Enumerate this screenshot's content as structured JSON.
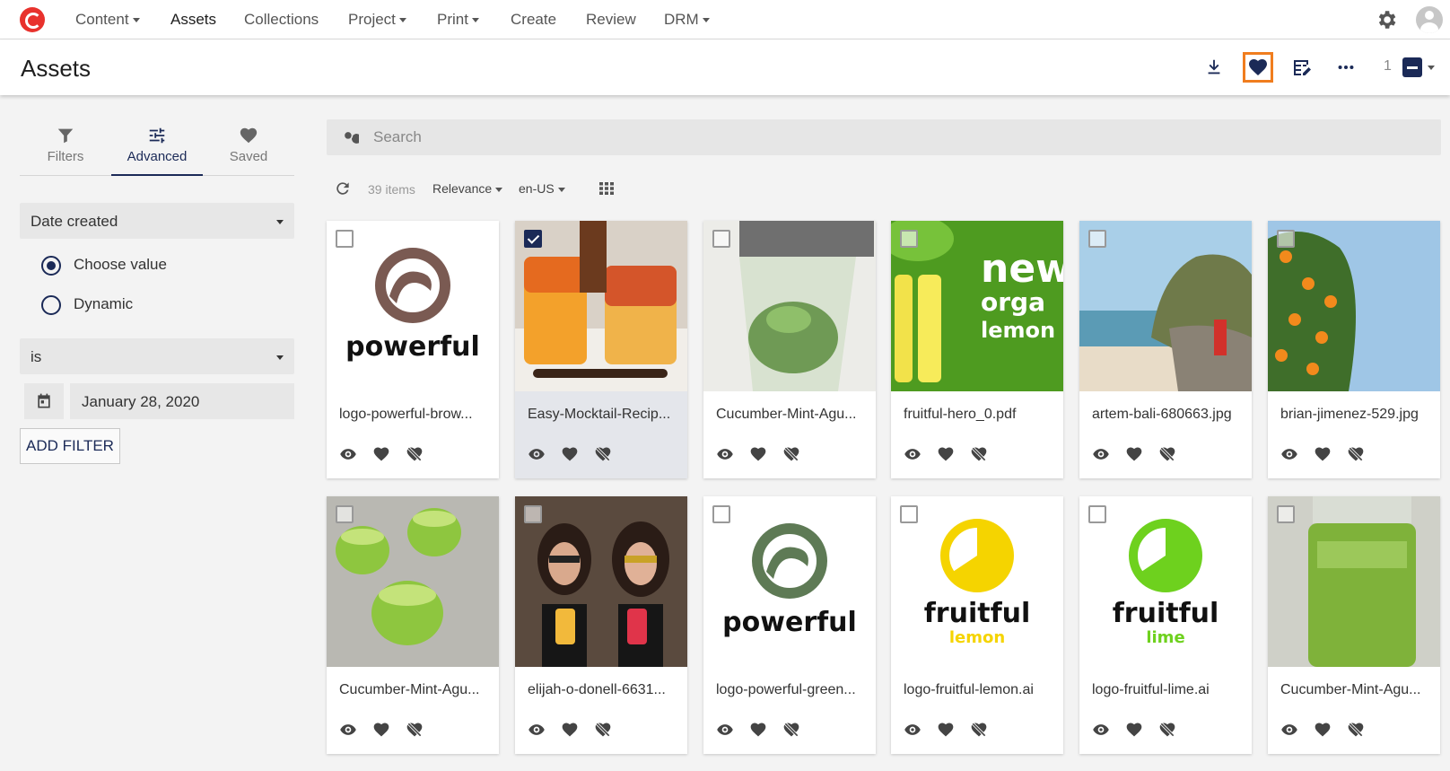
{
  "topnav": {
    "items": [
      {
        "label": "Content",
        "dropdown": true
      },
      {
        "label": "Assets",
        "dropdown": false,
        "active": true
      },
      {
        "label": "Collections",
        "dropdown": false
      },
      {
        "label": "Project",
        "dropdown": true
      },
      {
        "label": "Print",
        "dropdown": true
      },
      {
        "label": "Create",
        "dropdown": false
      },
      {
        "label": "Review",
        "dropdown": false
      },
      {
        "label": "DRM",
        "dropdown": true
      }
    ],
    "settings_icon": "gear-icon",
    "avatar_icon": "user-avatar-icon"
  },
  "header": {
    "title": "Assets",
    "actions": [
      "download-icon",
      "heart-icon",
      "edit-table-icon",
      "more-icon"
    ],
    "selected_count": "1",
    "accent": "#f07d1e"
  },
  "sidebar": {
    "tabs": [
      {
        "label": "Filters",
        "icon": "filter-icon"
      },
      {
        "label": "Advanced",
        "icon": "sliders-icon",
        "active": true
      },
      {
        "label": "Saved",
        "icon": "heart-icon"
      }
    ],
    "field_select": "Date created",
    "radio_options": [
      {
        "label": "Choose value",
        "checked": true
      },
      {
        "label": "Dynamic",
        "checked": false
      }
    ],
    "operator_select": "is",
    "date_value": "January 28, 2020",
    "add_filter_label": "ADD FILTER"
  },
  "search": {
    "placeholder": "Search"
  },
  "toolbar": {
    "count": "39 items",
    "sort": "Relevance",
    "locale": "en-US"
  },
  "assets": [
    {
      "name": "logo-powerful-brow...",
      "thumb": "logo-powerful-brown",
      "selected": false
    },
    {
      "name": "Easy-Mocktail-Recip...",
      "thumb": "mocktail",
      "selected": true
    },
    {
      "name": "Cucumber-Mint-Agu...",
      "thumb": "blender",
      "selected": false
    },
    {
      "name": "fruitful-hero_0.pdf",
      "thumb": "fruitful-hero",
      "selected": false
    },
    {
      "name": "artem-bali-680663.jpg",
      "thumb": "beach",
      "selected": false
    },
    {
      "name": "brian-jimenez-529.jpg",
      "thumb": "orange-tree",
      "selected": false
    },
    {
      "name": "Cucumber-Mint-Agu...",
      "thumb": "green-glasses",
      "selected": false
    },
    {
      "name": "elijah-o-donell-6631...",
      "thumb": "two-girls",
      "selected": false
    },
    {
      "name": "logo-powerful-green...",
      "thumb": "logo-powerful-green",
      "selected": false
    },
    {
      "name": "logo-fruitful-lemon.ai",
      "thumb": "logo-fruitful-lemon",
      "selected": false
    },
    {
      "name": "logo-fruitful-lime.ai",
      "thumb": "logo-fruitful-lime",
      "selected": false
    },
    {
      "name": "Cucumber-Mint-Agu...",
      "thumb": "green-jar",
      "selected": false
    }
  ],
  "thumb_text": {
    "powerful": "powerful",
    "fruitful": "fruitful",
    "lemon": "lemon",
    "lime": "lime",
    "hero_lines": [
      "new",
      "orga",
      "lemon"
    ]
  },
  "colors": {
    "primary": "#1b2a57",
    "brand_red": "#e8322d",
    "powerful_brown": "#7a5a52",
    "powerful_green": "#5e7a55",
    "lemon_yellow": "#f5d400",
    "lime_green": "#6ed11e"
  }
}
